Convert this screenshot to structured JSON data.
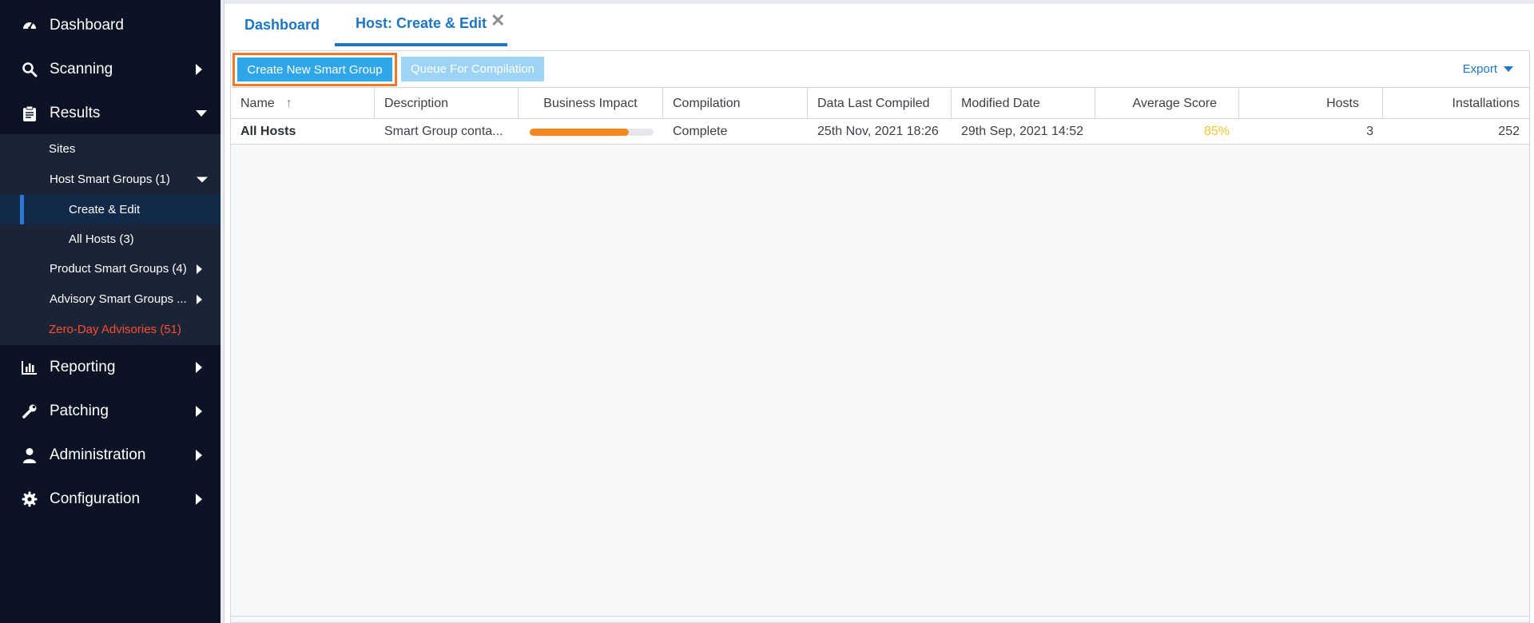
{
  "sidebar": {
    "main_items": [
      {
        "label": "Dashboard",
        "icon": "gauge-icon"
      },
      {
        "label": "Scanning",
        "icon": "search-icon"
      },
      {
        "label": "Results",
        "icon": "clipboard-icon"
      },
      {
        "label": "Reporting",
        "icon": "bar-chart-icon"
      },
      {
        "label": "Patching",
        "icon": "wrench-icon"
      },
      {
        "label": "Administration",
        "icon": "user-icon"
      },
      {
        "label": "Configuration",
        "icon": "gear-icon"
      }
    ],
    "results_sub": {
      "sites": "Sites",
      "host_smart_groups": "Host Smart Groups (1)",
      "create_edit": "Create & Edit",
      "all_hosts": "All Hosts (3)",
      "product_smart_groups": "Product Smart Groups (4)",
      "advisory_smart_groups": "Advisory Smart Groups ...",
      "zero_day": "Zero-Day Advisories (51)"
    },
    "colors": {
      "background": "#0c1324",
      "submenu": "#1a2436",
      "active": "#12294a",
      "zero_day": "#ff4d2e"
    }
  },
  "tabs": {
    "dashboard": "Dashboard",
    "host_create_edit": "Host: Create & Edit",
    "close_glyph": "✕"
  },
  "toolbar": {
    "create_label": "Create New Smart Group",
    "queue_label": "Queue For Compilation",
    "export_label": "Export"
  },
  "grid": {
    "columns": [
      "Name",
      "Description",
      "Business Impact",
      "Compilation",
      "Data Last Compiled",
      "Modified Date",
      "Average Score",
      "Hosts",
      "Installations"
    ],
    "rows": [
      {
        "name": "All Hosts",
        "description": "Smart Group conta...",
        "business_impact": 0.8,
        "compilation": "Complete",
        "data_last_compiled": "25th Nov, 2021 18:26",
        "modified_date": "29th Sep, 2021 14:52",
        "average_score": "85%",
        "hosts": "3",
        "installations": "252"
      }
    ]
  },
  "colors": {
    "accent": "#1c76c3",
    "button": "#2ea6e8",
    "button_disabled": "#9dd3f4",
    "highlight_border": "#f0772b",
    "impact": "#f6861f",
    "score": "#f2c230"
  }
}
